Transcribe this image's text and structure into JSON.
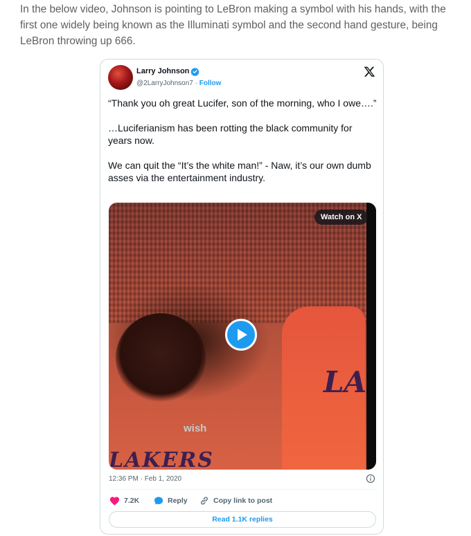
{
  "article": {
    "paragraph": "In the below video, Johnson is pointing to LeBron making a symbol with his hands, with the first one widely being known as the Illuminati symbol and the second hand gesture, being LeBron throwing up 666."
  },
  "tweet": {
    "author_name": "Larry Johnson",
    "author_handle": "@2LarryJohnson7",
    "separator": "·",
    "follow_label": "Follow",
    "text_lines": [
      "“Thank you oh great Lucifer, son of the morning, who I owe….”",
      "…Luciferianism has been rotting the black community for years now.",
      "We can quit the “It’s the white man!” - Naw, it’s our own dumb asses via the entertainment industry."
    ],
    "video": {
      "watch_label": "Watch on X",
      "jersey_text": "LA",
      "left_jersey_text": "LAKERS",
      "sponsor_text": "wish"
    },
    "timestamp": "12:36 PM · Feb 1, 2020",
    "actions": {
      "likes": "7.2K",
      "reply_label": "Reply",
      "copy_label": "Copy link to post"
    },
    "read_replies_label": "Read 1.1K replies"
  },
  "colors": {
    "accent": "#1d9bf0",
    "like": "#f91880",
    "secondary_text": "#536471"
  }
}
